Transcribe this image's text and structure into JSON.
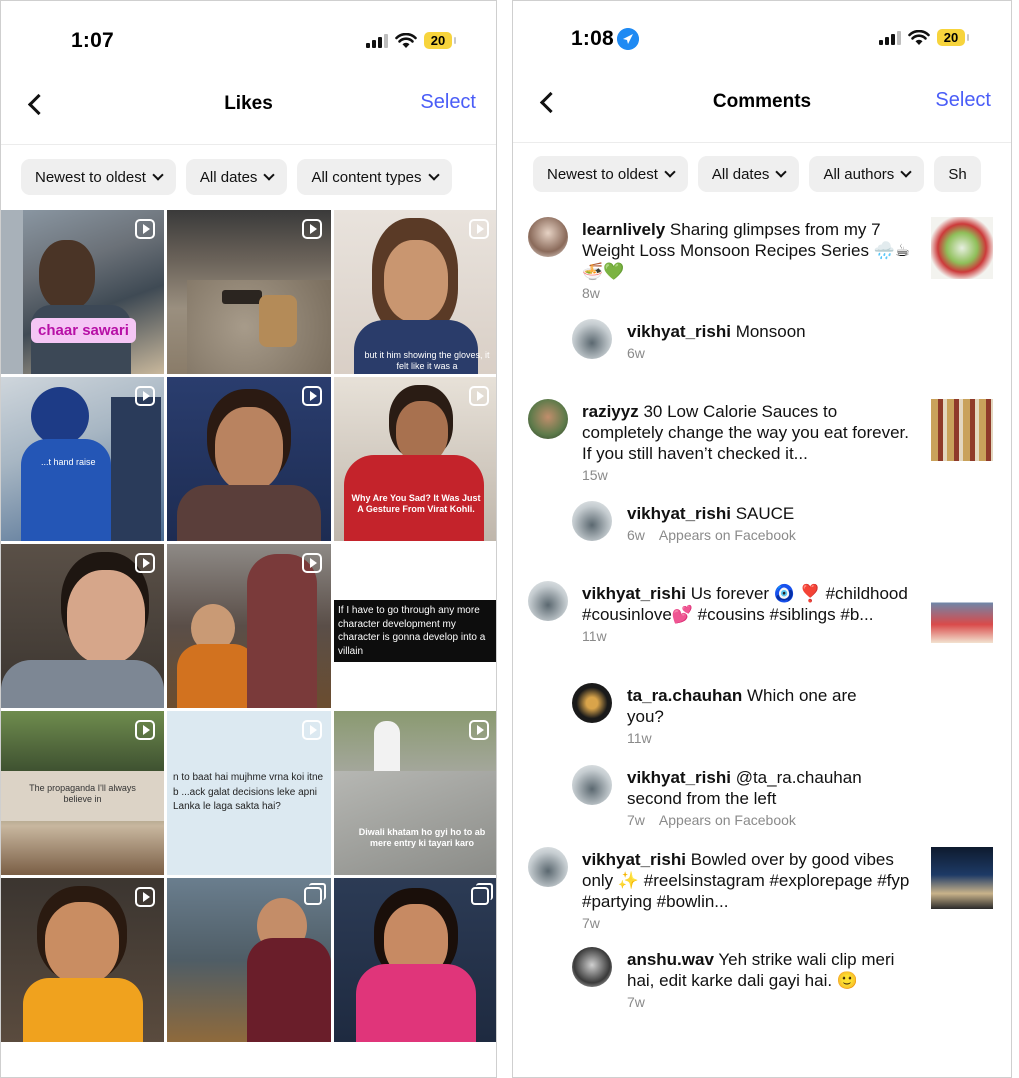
{
  "left": {
    "status": {
      "time": "1:07",
      "battery": "20"
    },
    "nav": {
      "title": "Likes",
      "select": "Select"
    },
    "filters": [
      "Newest to oldest",
      "All dates",
      "All content types"
    ],
    "tiles": {
      "t1_label": "chaar sawari",
      "t3_caption": "but it him showing the gloves, it felt like it was a",
      "t4_caption": "...t hand raise",
      "t6_caption": "Why Are You Sad? It Was Just A Gesture From Virat Kohli.",
      "t9_text": "If I have to go through any more character development my character is gonna develop into a villain",
      "t11_text": "n to baat hai mujhme vrna koi itne b ...ack galat decisions leke apni Lanka le laga sakta hai?",
      "t12_caption": "Diwali khatam ho gyi ho to ab mere entry ki tayari karo"
    }
  },
  "right": {
    "status": {
      "time": "1:08",
      "battery": "20"
    },
    "nav": {
      "title": "Comments",
      "select": "Select"
    },
    "filters": [
      "Newest to oldest",
      "All dates",
      "All authors",
      "Sh"
    ],
    "comments": [
      {
        "user": "learnlively",
        "text": "Sharing glimpses from my 7 Weight Loss Monsoon Recipes Series 🌧️☕🍜💚",
        "time": "8w"
      },
      {
        "user": "vikhyat_rishi",
        "text": "Monsoon",
        "time": "6w"
      },
      {
        "user": "raziyyz",
        "text": "30 Low Calorie Sauces to completely change the way you eat forever. If you still haven’t checked it...",
        "time": "15w"
      },
      {
        "user": "vikhyat_rishi",
        "text": "SAUCE",
        "time": "6w",
        "extra": "Appears on Facebook"
      },
      {
        "user": "vikhyat_rishi",
        "text": "Us forever 🧿 ❣️ #childhood #cousinlove💕 #cousins #siblings #b...",
        "time": "11w"
      },
      {
        "user": "ta_ra.chauhan",
        "text": "Which one are you?",
        "time": "11w"
      },
      {
        "user": "vikhyat_rishi",
        "text": "@ta_ra.chauhan second from the left",
        "time": "7w",
        "extra": "Appears on Facebook"
      },
      {
        "user": "vikhyat_rishi",
        "text": "Bowled over by good vibes only ✨ #reelsinstagram #explorepage #fyp #partying #bowlin...",
        "time": "7w"
      },
      {
        "user": "anshu.wav",
        "text": "Yeh strike wali clip meri hai, edit karke dali gayi hai. 🙂",
        "time": "7w"
      }
    ]
  },
  "colors": {
    "accent": "#4a5df7",
    "battery": "#f7d43c",
    "chip": "#efefef",
    "meta": "#8a8a8a"
  }
}
